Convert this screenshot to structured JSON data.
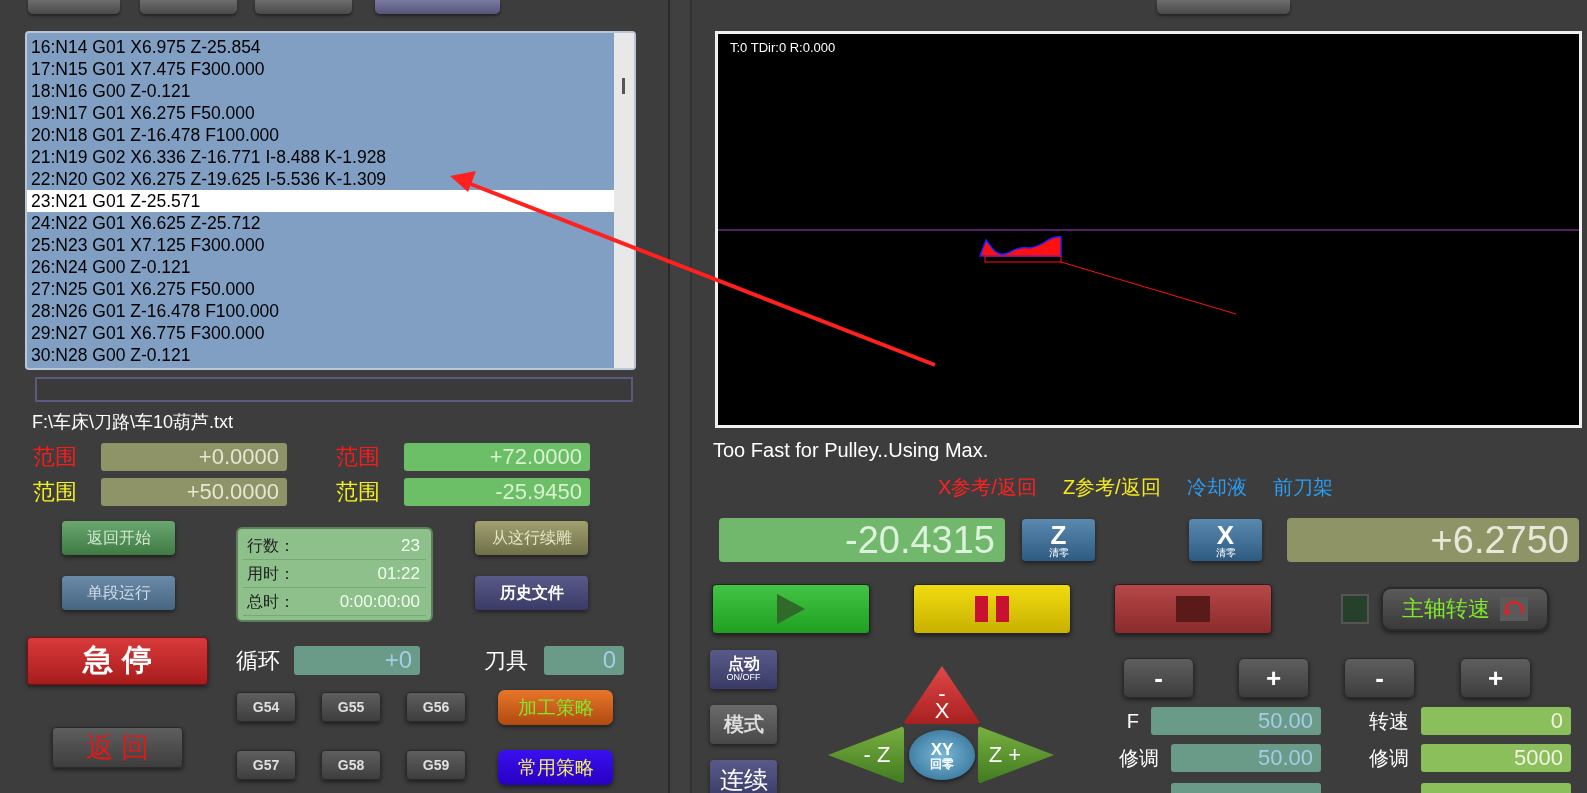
{
  "program": {
    "lines": [
      {
        "text": "16:N14 G01 X6.975 Z-25.854",
        "selected": false
      },
      {
        "text": "17:N15 G01 X7.475 F300.000",
        "selected": false
      },
      {
        "text": "18:N16 G00 Z-0.121",
        "selected": false
      },
      {
        "text": "19:N17 G01 X6.275 F50.000",
        "selected": false
      },
      {
        "text": "20:N18 G01 Z-16.478 F100.000",
        "selected": false
      },
      {
        "text": "21:N19 G02 X6.336 Z-16.771 I-8.488 K-1.928",
        "selected": false
      },
      {
        "text": "22:N20 G02 X6.275 Z-19.625 I-5.536 K-1.309",
        "selected": false
      },
      {
        "text": "23:N21 G01 Z-25.571",
        "selected": true
      },
      {
        "text": "24:N22 G01 X6.625 Z-25.712",
        "selected": false
      },
      {
        "text": "25:N23 G01 X7.125 F300.000",
        "selected": false
      },
      {
        "text": "26:N24 G00 Z-0.121",
        "selected": false
      },
      {
        "text": "27:N25 G01 X6.275 F50.000",
        "selected": false
      },
      {
        "text": "28:N26 G01 Z-16.478 F100.000",
        "selected": false
      },
      {
        "text": "29:N27 G01 X6.775 F300.000",
        "selected": false
      },
      {
        "text": "30:N28 G00 Z-0.121",
        "selected": false
      }
    ],
    "progress": {
      "level": 0
    },
    "file_path": "F:\\车床\\刀路\\车10葫芦.txt"
  },
  "ranges": [
    {
      "items": [
        {
          "label": "范围",
          "value": "+0.0000",
          "color": "#ff1a1a"
        },
        {
          "label": "范围",
          "value": "+50.0000",
          "color": "#f4f020"
        }
      ]
    },
    {
      "items": [
        {
          "label": "范围",
          "value": "+72.0000",
          "color": "#ff1a1a"
        },
        {
          "label": "范围",
          "value": "-25.9450",
          "color": "#f4f020"
        }
      ]
    }
  ],
  "left_buttons": [
    {
      "label": "返回开始",
      "kind": "green"
    },
    {
      "label": "单段运行",
      "kind": "slate"
    },
    {
      "label": "从这行续雕",
      "kind": "olive"
    },
    {
      "label": "历史文件",
      "kind": "navy"
    }
  ],
  "counters": [
    {
      "label": "行数：",
      "value": "23"
    },
    {
      "label": "用时：",
      "value": "01:22"
    },
    {
      "label": "总时：",
      "value": "0:00:00:00"
    }
  ],
  "estop": {
    "label": "急 停"
  },
  "back": {
    "label": "返 回"
  },
  "loop": {
    "label": "循环",
    "value": "+0"
  },
  "tool": {
    "label": "刀具",
    "value": "0"
  },
  "offsets": [
    "G54",
    "G55",
    "G56",
    "G57",
    "G58",
    "G59"
  ],
  "strategies": [
    {
      "label": "加工策略",
      "kind": "orange"
    },
    {
      "label": "常用策略",
      "kind": "blue"
    }
  ],
  "viewport": {
    "overlay_text": "T:0 TDir:0 R:0.000"
  },
  "message": "Too Fast for Pulley..Using Max.",
  "indicators": [
    {
      "label": "X参考/返回",
      "color": "#ff2020"
    },
    {
      "label": "Z参考/返回",
      "color": "#f4ea20"
    },
    {
      "label": "冷却液",
      "color": "#2a9df4"
    },
    {
      "label": "前刀架",
      "color": "#2a9df4"
    }
  ],
  "dro": {
    "z_value": "-20.4315",
    "z_zero": {
      "letter": "Z",
      "caption": "清零"
    },
    "x_zero": {
      "letter": "X",
      "caption": "清零"
    },
    "x_value": "+6.2750"
  },
  "transport": [
    {
      "kind": "play"
    },
    {
      "kind": "pause"
    },
    {
      "kind": "stop"
    }
  ],
  "spindle": {
    "label": "主轴转速"
  },
  "jog_modes": [
    {
      "label": "点动",
      "caption": "ON/OFF"
    },
    {
      "label": "模式"
    },
    {
      "label": "连续"
    }
  ],
  "jog": {
    "x_minus": {
      "sign": "-",
      "axis": "X"
    },
    "z_minus": "- Z",
    "home": {
      "axes": "XY",
      "caption": "回零"
    },
    "z_plus": "Z +"
  },
  "adjust": [
    {
      "minus": "-",
      "plus": "+"
    },
    {
      "minus": "-",
      "plus": "+"
    }
  ],
  "feed": [
    {
      "label": "F",
      "value": "50.00"
    },
    {
      "label": "修调",
      "value": "50.00"
    }
  ],
  "speed": [
    {
      "label": "转速",
      "value": "0"
    },
    {
      "label": "修调",
      "value": "5000"
    }
  ]
}
